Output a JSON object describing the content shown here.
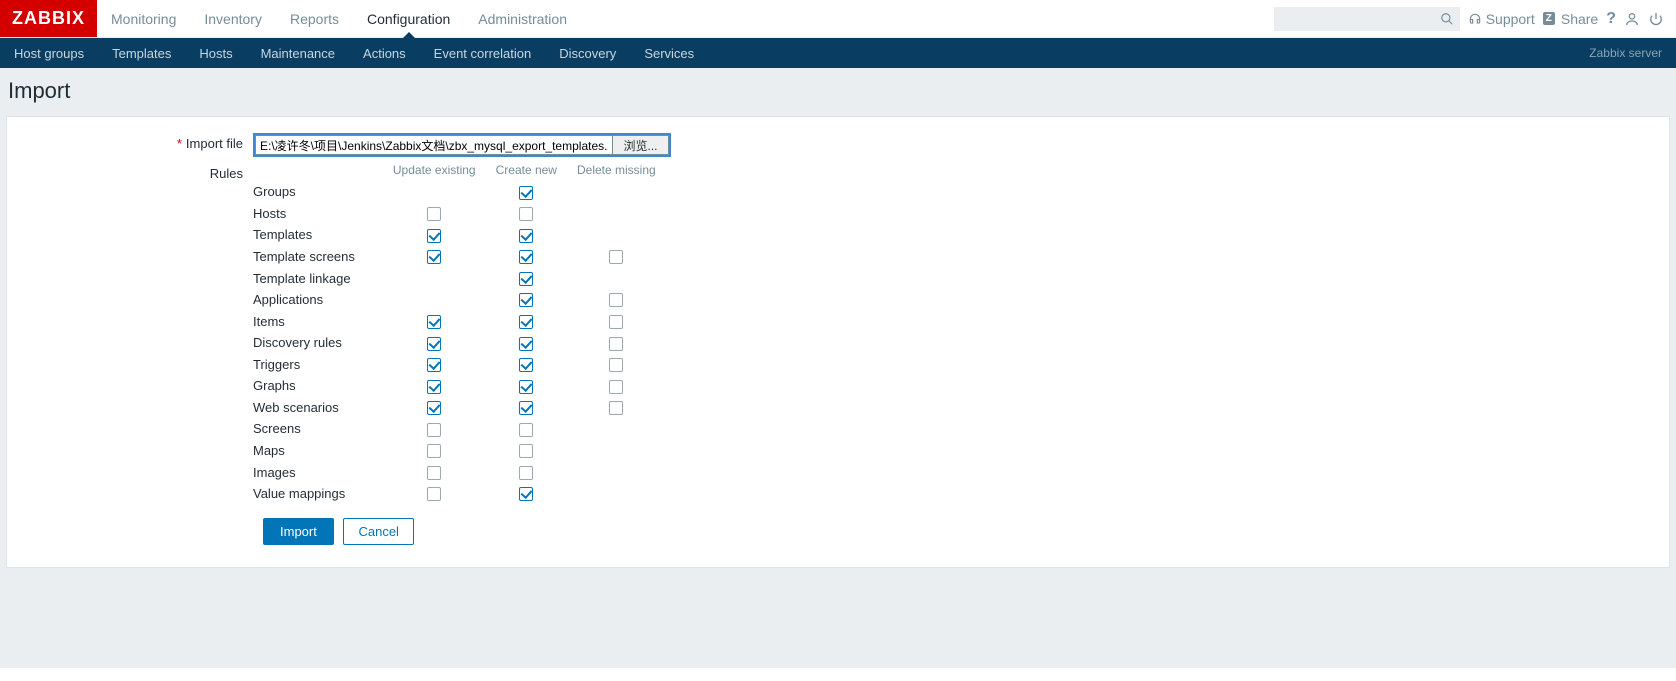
{
  "header": {
    "logo": "ZABBIX",
    "main_menu": [
      "Monitoring",
      "Inventory",
      "Reports",
      "Configuration",
      "Administration"
    ],
    "active_main_index": 3,
    "support": "Support",
    "share": "Share",
    "server_label": "Zabbix server",
    "sub_menu": [
      "Host groups",
      "Templates",
      "Hosts",
      "Maintenance",
      "Actions",
      "Event correlation",
      "Discovery",
      "Services"
    ]
  },
  "page": {
    "title": "Import",
    "import_file_label": "Import file",
    "file_path": "E:\\凌许冬\\项目\\Jenkins\\Zabbix文档\\zbx_mysql_export_templates.xml",
    "browse_btn": "浏览...",
    "rules_label": "Rules",
    "rules_headers": [
      "Update existing",
      "Create new",
      "Delete missing"
    ],
    "rules": [
      {
        "name": "Groups",
        "update": null,
        "create": true,
        "delete": null
      },
      {
        "name": "Hosts",
        "update": false,
        "create": false,
        "delete": null
      },
      {
        "name": "Templates",
        "update": true,
        "create": true,
        "delete": null
      },
      {
        "name": "Template screens",
        "update": true,
        "create": true,
        "delete": false
      },
      {
        "name": "Template linkage",
        "update": null,
        "create": true,
        "delete": null
      },
      {
        "name": "Applications",
        "update": null,
        "create": true,
        "delete": false
      },
      {
        "name": "Items",
        "update": true,
        "create": true,
        "delete": false
      },
      {
        "name": "Discovery rules",
        "update": true,
        "create": true,
        "delete": false
      },
      {
        "name": "Triggers",
        "update": true,
        "create": true,
        "delete": false
      },
      {
        "name": "Graphs",
        "update": true,
        "create": true,
        "delete": false
      },
      {
        "name": "Web scenarios",
        "update": true,
        "create": true,
        "delete": false
      },
      {
        "name": "Screens",
        "update": false,
        "create": false,
        "delete": null
      },
      {
        "name": "Maps",
        "update": false,
        "create": false,
        "delete": null
      },
      {
        "name": "Images",
        "update": false,
        "create": false,
        "delete": null
      },
      {
        "name": "Value mappings",
        "update": false,
        "create": true,
        "delete": null
      }
    ],
    "submit_btn": "Import",
    "cancel_btn": "Cancel"
  }
}
